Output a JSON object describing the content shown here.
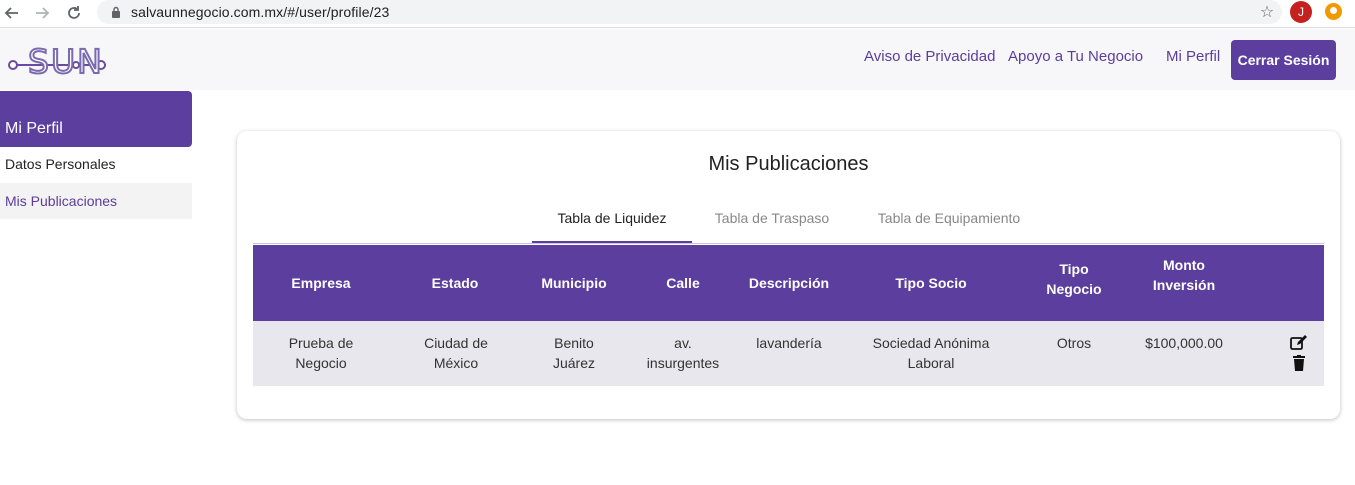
{
  "browser": {
    "url": "salvaunnegocio.com.mx/#/user/profile/23",
    "profile_initial": "J"
  },
  "header": {
    "logo_text": "SUN",
    "nav": [
      "Aviso de Privacidad",
      "Apoyo a Tu Negocio",
      "Mi Perfil"
    ],
    "logout_label": "Cerrar Sesión",
    "accent_color": "#5b3e9e"
  },
  "sidebar": {
    "title": "Mi Perfil",
    "items": [
      {
        "label": "Datos Personales",
        "active": false
      },
      {
        "label": "Mis Publicaciones",
        "active": true
      }
    ]
  },
  "main": {
    "title": "Mis Publicaciones",
    "tabs": [
      {
        "label": "Tabla de Liquidez",
        "active": true
      },
      {
        "label": "Tabla de Traspaso",
        "active": false
      },
      {
        "label": "Tabla de Equipamiento",
        "active": false
      }
    ],
    "table": {
      "headers": [
        "Empresa",
        "Estado",
        "Municipio",
        "Calle",
        "Descripción",
        "Tipo Socio",
        "Tipo Negocio",
        "Monto Inversión"
      ],
      "rows": [
        {
          "empresa": "Prueba de Negocio",
          "estado": "Ciudad de México",
          "municipio": "Benito Juárez",
          "calle": "av. insurgentes",
          "descripcion": "lavandería",
          "tipo_socio": "Sociedad Anónima Laboral",
          "tipo_negocio": "Otros",
          "monto_inversion": "$100,000.00"
        }
      ],
      "row_actions": [
        "edit-icon",
        "trash-icon"
      ]
    }
  }
}
